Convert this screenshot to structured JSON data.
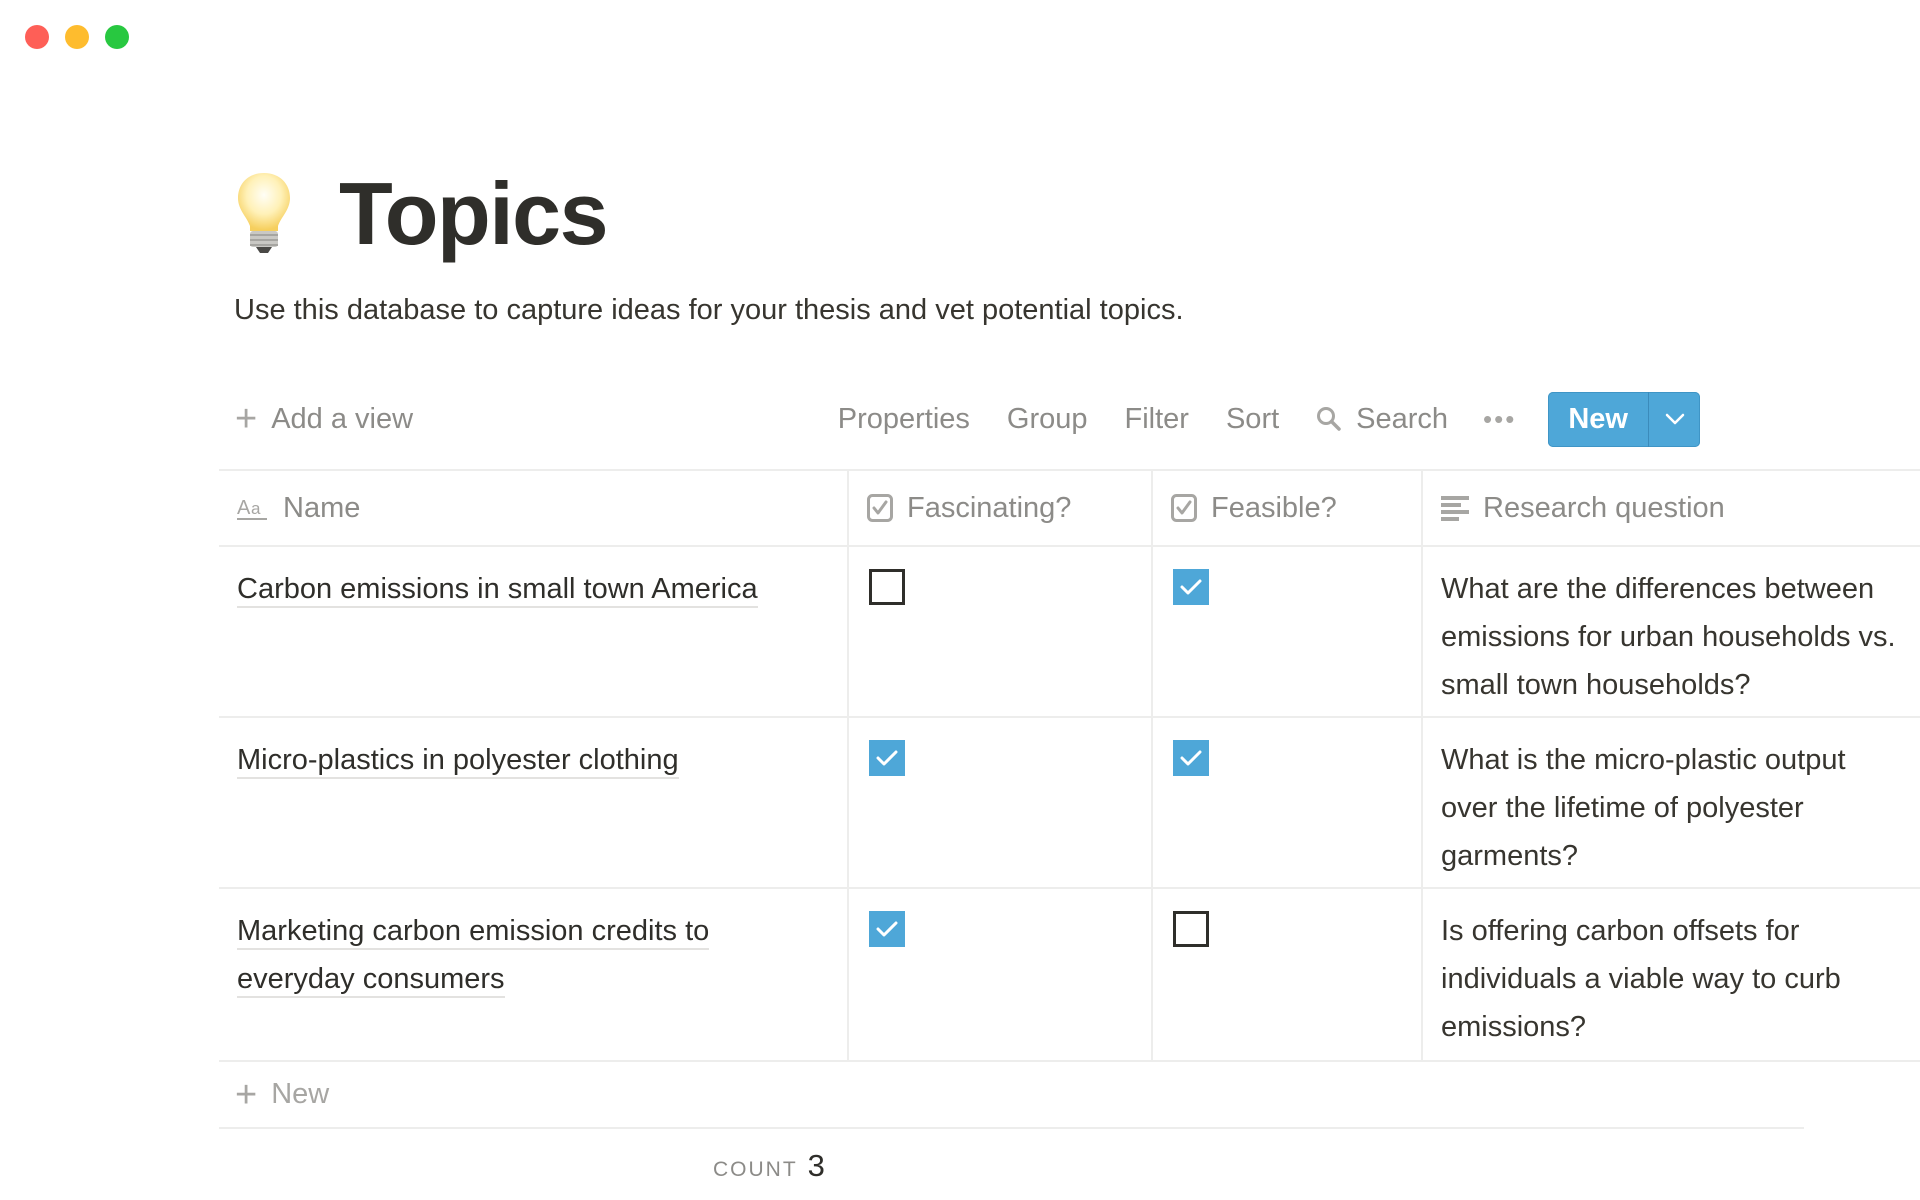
{
  "window": {
    "controls": [
      "close",
      "minimize",
      "maximize"
    ],
    "colors": {
      "close": "#fe5f57",
      "minimize": "#febc2e",
      "maximize": "#28c840"
    }
  },
  "page": {
    "icon": "lightbulb-emoji",
    "title": "Topics",
    "description": "Use this database to capture ideas for your thesis and vet potential topics."
  },
  "toolbar": {
    "add_view_label": "Add a view",
    "properties_label": "Properties",
    "group_label": "Group",
    "filter_label": "Filter",
    "sort_label": "Sort",
    "search_label": "Search",
    "more_label": "•••",
    "new_label": "New",
    "accent_color": "#4ea7d8"
  },
  "table": {
    "columns": [
      {
        "label": "Name",
        "icon": "title-property-icon"
      },
      {
        "label": "Fascinating?",
        "icon": "checkbox-property-icon"
      },
      {
        "label": "Feasible?",
        "icon": "checkbox-property-icon"
      },
      {
        "label": "Research question",
        "icon": "text-property-icon"
      }
    ],
    "rows": [
      {
        "name": "Carbon emissions in small town America",
        "fascinating": false,
        "feasible": true,
        "research_question_lines": [
          "What are the differences between",
          "emissions for urban households vs.",
          "small town households?"
        ]
      },
      {
        "name": "Micro-plastics in polyester clothing",
        "fascinating": true,
        "feasible": true,
        "research_question_lines": [
          "What is the micro-plastic output",
          "over the lifetime of polyester",
          "garments?"
        ]
      },
      {
        "name_lines": [
          "Marketing carbon emission credits to",
          "everyday consumers"
        ],
        "fascinating": true,
        "feasible": false,
        "research_question_lines": [
          "Is offering carbon offsets for",
          "individuals a viable way to curb",
          "emissions?"
        ]
      }
    ],
    "new_row_label": "New",
    "footer": {
      "count_label": "COUNT",
      "count_value": "3"
    }
  }
}
